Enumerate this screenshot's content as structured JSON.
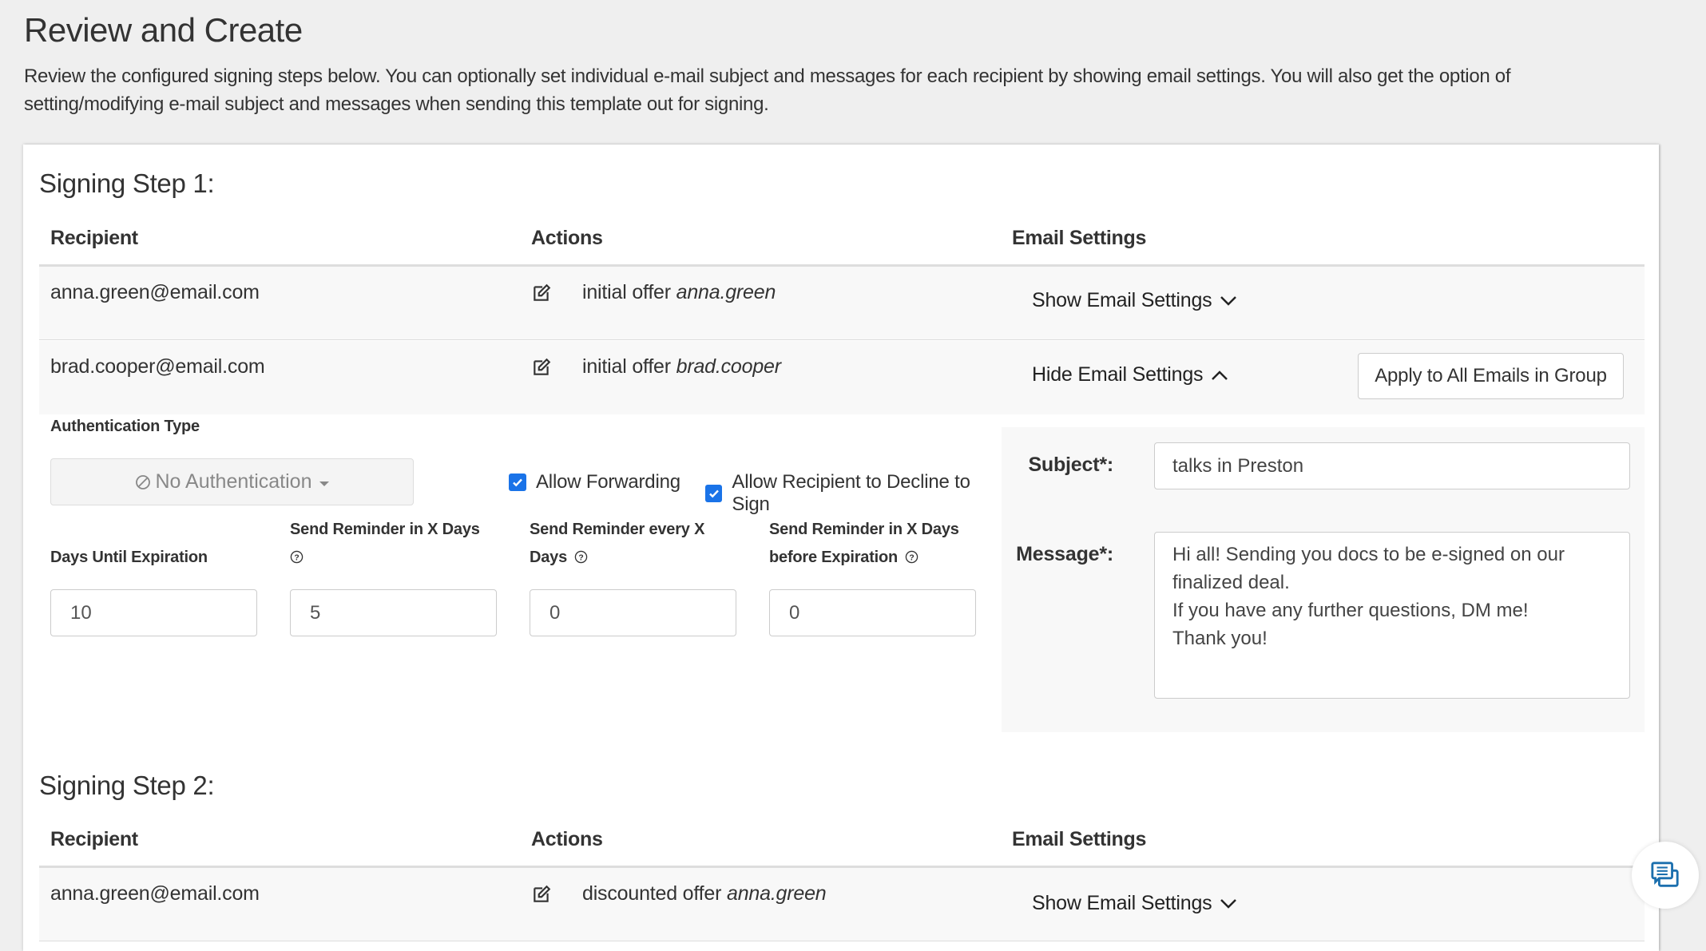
{
  "page": {
    "title": "Review and Create",
    "description": "Review the configured signing steps below. You can optionally set individual e-mail subject and messages for each recipient by showing email settings. You will also get the option of setting/modifying e-mail subject and messages when sending this template out for signing."
  },
  "table_headers": {
    "recipient": "Recipient",
    "actions": "Actions",
    "email_settings": "Email Settings"
  },
  "steps": [
    {
      "title": "Signing Step 1:",
      "rows": [
        {
          "email": "anna.green@email.com",
          "action_prefix": "initial offer",
          "action_name": "anna.green",
          "toggle_label": "Show Email Settings",
          "toggle_icon": "chevron-down-icon"
        },
        {
          "email": "brad.cooper@email.com",
          "action_prefix": "initial offer",
          "action_name": "brad.cooper",
          "toggle_label": "Hide Email Settings",
          "toggle_icon": "chevron-up-icon",
          "apply_button": "Apply to All Emails in Group",
          "expanded": {
            "auth_type_label": "Authentication Type",
            "auth_type_value": "No Authentication",
            "allow_forwarding_label": "Allow Forwarding",
            "allow_forwarding_checked": true,
            "allow_decline_label": "Allow Recipient to Decline to Sign",
            "allow_decline_checked": true,
            "days_until_expiration_label": "Days Until Expiration",
            "days_until_expiration_value": "10",
            "send_reminder_in_label": "Send Reminder in X Days",
            "send_reminder_in_value": "5",
            "send_reminder_every_label_1": "Send Reminder every X",
            "send_reminder_every_label_2": "Days",
            "send_reminder_every_value": "0",
            "send_reminder_before_label_1": "Send Reminder in X Days",
            "send_reminder_before_label_2": "before Expiration",
            "send_reminder_before_value": "0",
            "subject_label": "Subject*:",
            "subject_value": "talks in Preston",
            "message_label": "Message*:",
            "message_value": "Hi all! Sending you docs to be e-signed on our finalized deal.\nIf you have any further questions, DM me!\nThank you!"
          }
        }
      ]
    },
    {
      "title": "Signing Step 2:",
      "rows": [
        {
          "email": "anna.green@email.com",
          "action_prefix": "discounted offer",
          "action_name": "anna.green",
          "toggle_label": "Show Email Settings",
          "toggle_icon": "chevron-down-icon"
        }
      ]
    }
  ],
  "colors": {
    "checkbox": "#1a73e8",
    "chat_icon": "#1b6fae"
  }
}
